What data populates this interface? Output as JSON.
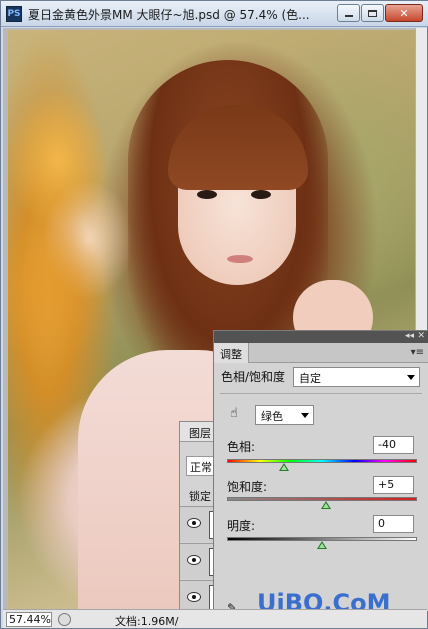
{
  "window": {
    "app_icon": "PS",
    "title": "夏日金黄色外景MM    大眼仔~旭.psd @ 57.4% (色...",
    "buttons": [
      "minimize-icon",
      "maximize-icon",
      "close-icon"
    ]
  },
  "status": {
    "zoom": "57.44%",
    "doc_info": "文档:1.96M/"
  },
  "layers_panel": {
    "tab_label": "图层",
    "blend_mode": "正常",
    "lock_label": "锁定"
  },
  "adjustments": {
    "tab_label": "调整",
    "preset_label": "色相/饱和度",
    "preset_value": "自定",
    "range_value": "绿色",
    "sliders": [
      {
        "label": "色相:",
        "value": "-40",
        "position": 0.3
      },
      {
        "label": "饱和度:",
        "value": "+5",
        "position": 0.52
      },
      {
        "label": "明度:",
        "value": "0",
        "position": 0.5
      }
    ]
  },
  "watermark": "UiBQ.CoM"
}
